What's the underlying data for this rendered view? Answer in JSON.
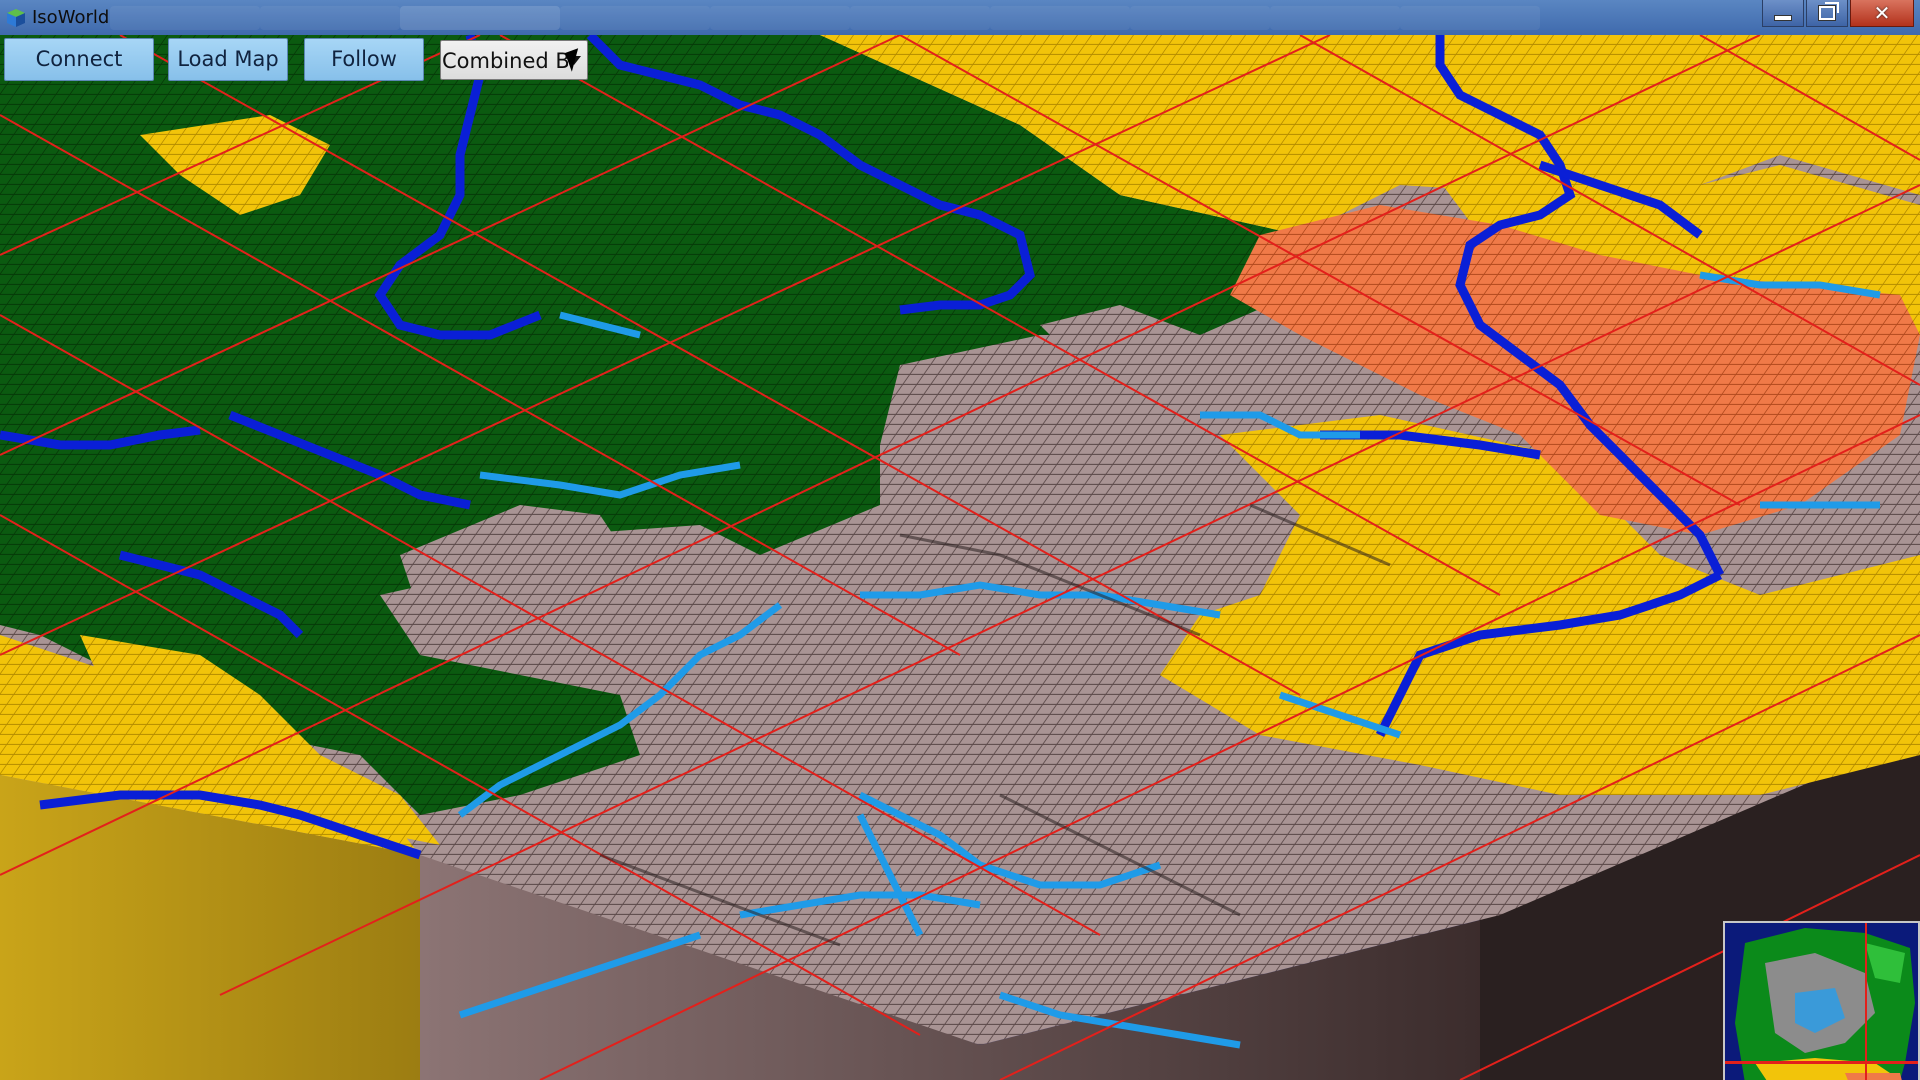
{
  "window": {
    "title": "IsoWorld",
    "icon": "isoworld-cube-icon"
  },
  "toolbar": {
    "connect_label": "Connect",
    "load_map_label": "Load Map",
    "follow_label": "Follow",
    "view_mode_value": "Combined Bio"
  },
  "colors": {
    "ocean": "#0b1a7a",
    "forest": "#0b5a10",
    "grassland": "#f2c40a",
    "rock": "#a99494",
    "desert": "#f07a48",
    "river_main": "#0a1fd6",
    "river_small": "#1f9be8",
    "grid_lines": "#e3201b",
    "cliff": "#b89a2a"
  }
}
